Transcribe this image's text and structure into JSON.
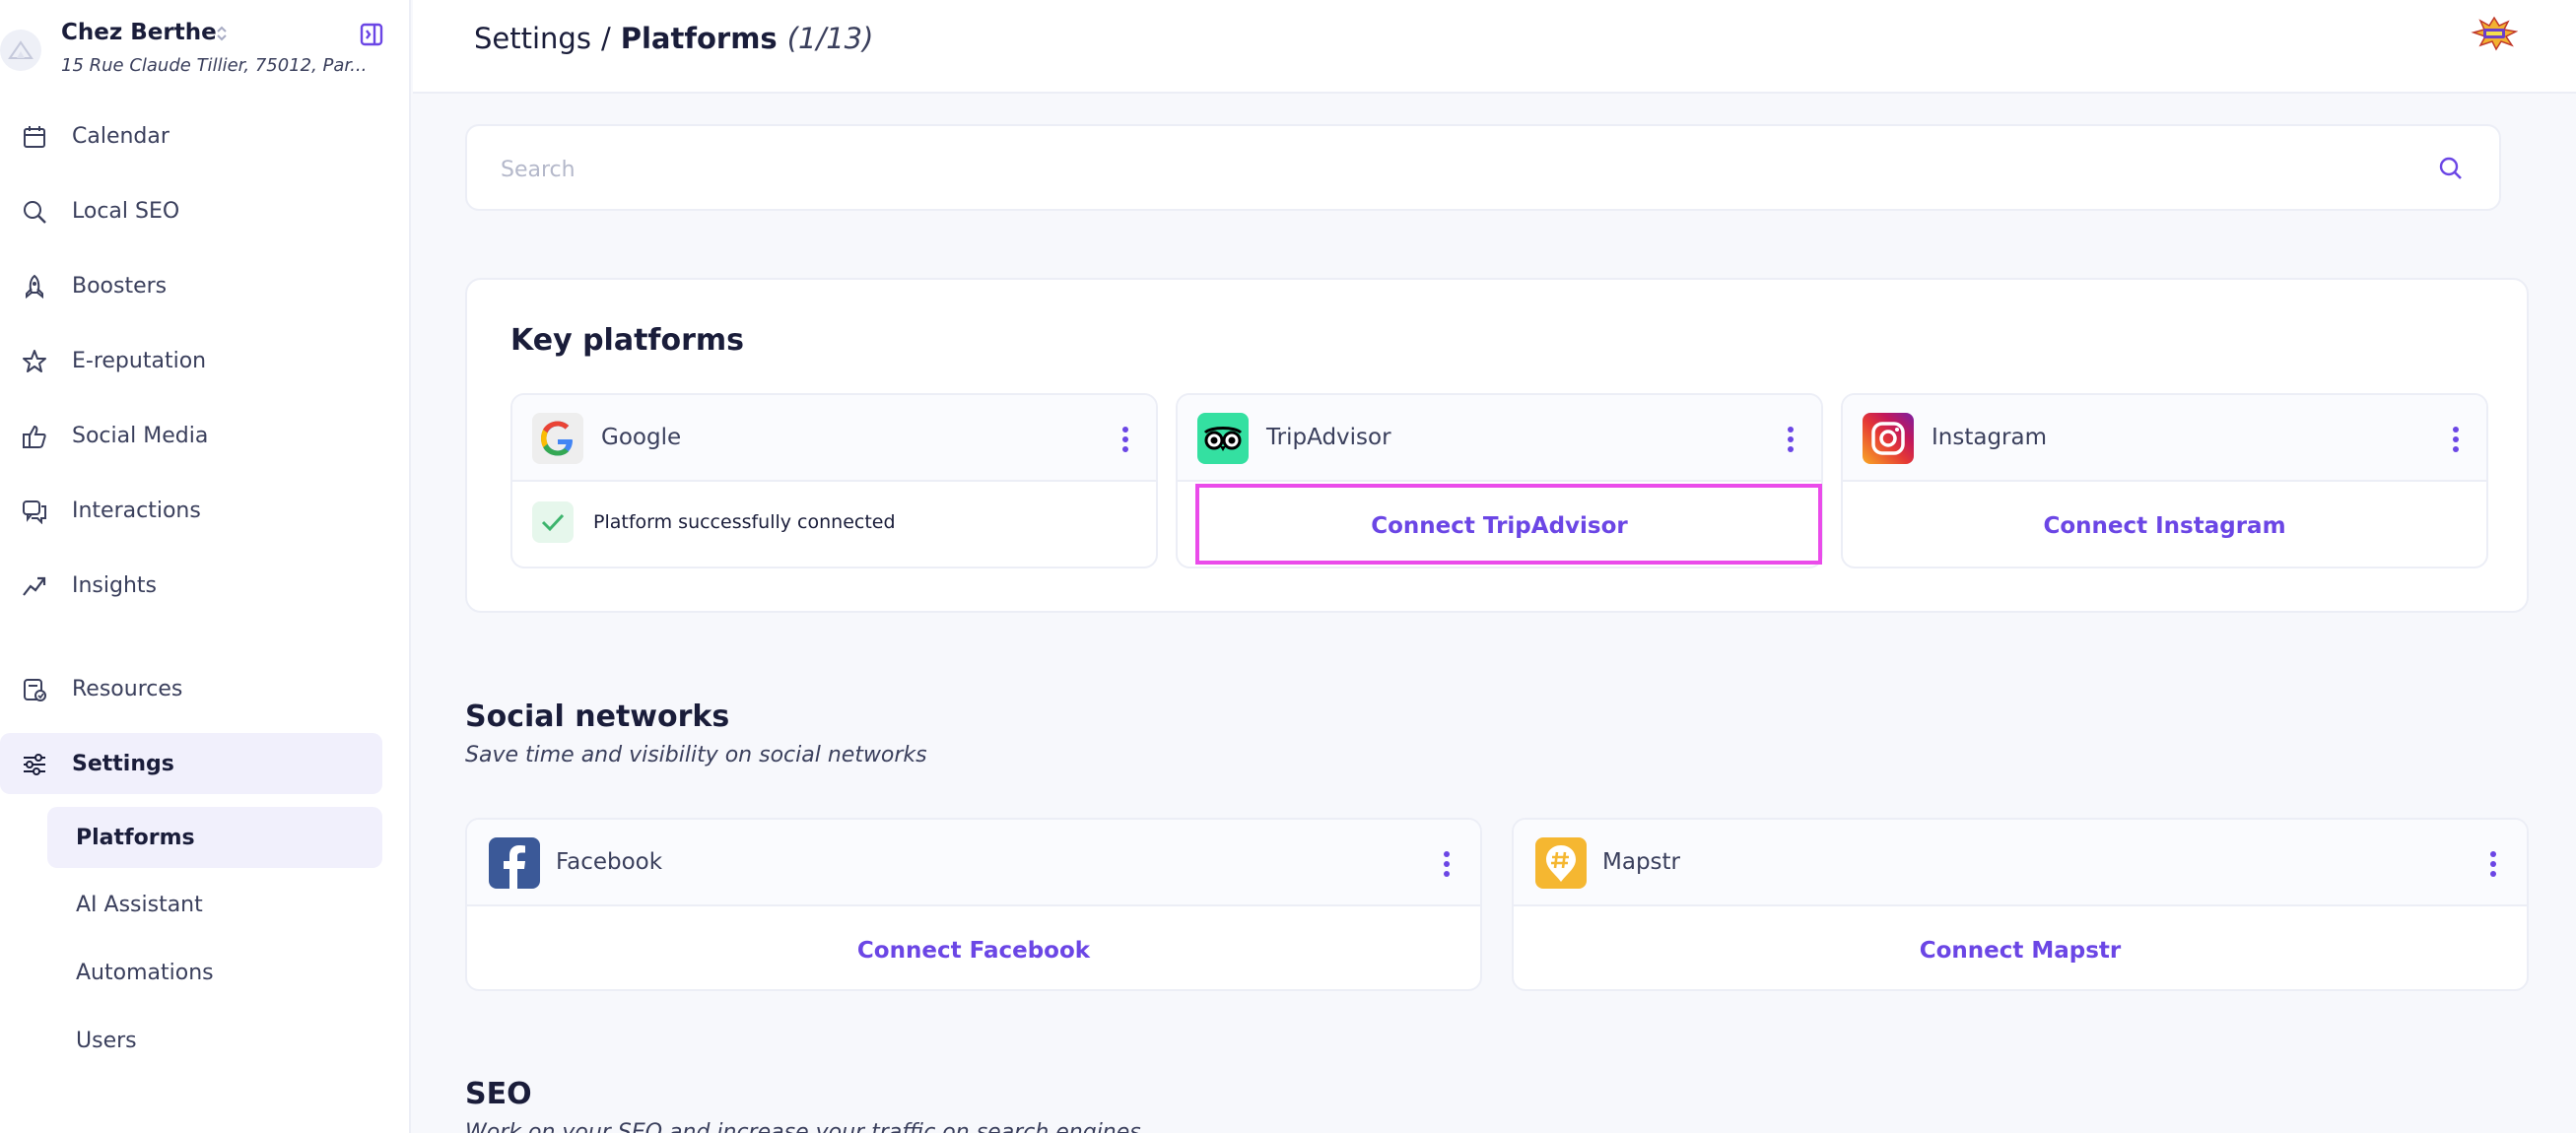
{
  "sidebar": {
    "restaurant": {
      "name": "Chez Berthe",
      "address": "15 Rue Claude Tillier, 75012, Par..."
    },
    "nav": [
      {
        "label": "Calendar",
        "icon": "calendar-icon"
      },
      {
        "label": "Local SEO",
        "icon": "search-icon"
      },
      {
        "label": "Boosters",
        "icon": "rocket-icon"
      },
      {
        "label": "E-reputation",
        "icon": "star-icon"
      },
      {
        "label": "Social Media",
        "icon": "thumbs-up-icon"
      },
      {
        "label": "Interactions",
        "icon": "chat-icon"
      },
      {
        "label": "Insights",
        "icon": "trend-icon"
      },
      {
        "label": "Resources",
        "icon": "resources-icon"
      },
      {
        "label": "Settings",
        "icon": "sliders-icon",
        "active": true
      }
    ],
    "settings_sub": [
      {
        "label": "Platforms",
        "active": true
      },
      {
        "label": "AI Assistant"
      },
      {
        "label": "Automations"
      },
      {
        "label": "Users"
      }
    ]
  },
  "header": {
    "breadcrumb_root": "Settings",
    "breadcrumb_sep": "/",
    "breadcrumb_current": "Platforms",
    "count": "(1/13)"
  },
  "search": {
    "placeholder": "Search",
    "value": ""
  },
  "key_platforms": {
    "title": "Key platforms",
    "cards": [
      {
        "name": "Google",
        "status": "Platform successfully connected"
      },
      {
        "name": "TripAdvisor",
        "action": "Connect TripAdvisor"
      },
      {
        "name": "Instagram",
        "action": "Connect Instagram"
      }
    ]
  },
  "social_networks": {
    "title": "Social networks",
    "subtitle": "Save time and visibility on social networks",
    "cards": [
      {
        "name": "Facebook",
        "action": "Connect Facebook"
      },
      {
        "name": "Mapstr",
        "action": "Connect Mapstr"
      }
    ]
  },
  "seo": {
    "title": "SEO",
    "subtitle": "Work on your SEO and increase your traffic on search engines"
  },
  "colors": {
    "accent": "#6b46e5",
    "active_bg": "#f1f0fc",
    "highlight": "#ea4bea",
    "success": "#3db46d"
  }
}
